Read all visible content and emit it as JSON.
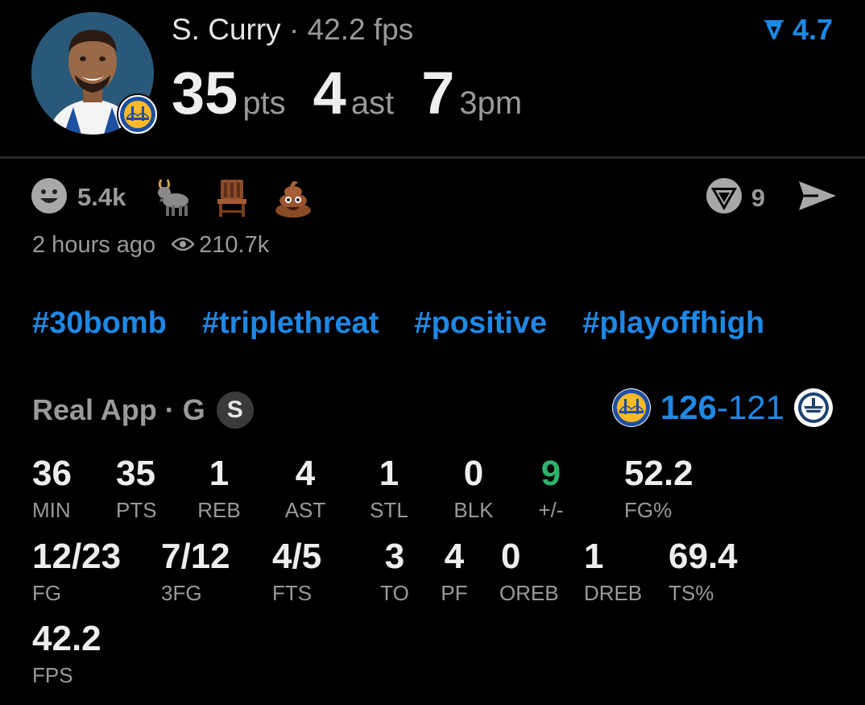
{
  "player": {
    "name": "S. Curry",
    "separator": "·",
    "fps_label": "42.2 fps"
  },
  "headline": [
    {
      "value": "35",
      "unit": "pts"
    },
    {
      "value": "4",
      "unit": "ast"
    },
    {
      "value": "7",
      "unit": "3pm"
    }
  ],
  "rating": {
    "value": "4.7",
    "icon": "rating-funnel-icon",
    "color": "#1e88e5"
  },
  "reactions": {
    "count": "5.4k",
    "emojis": [
      "goat-emoji",
      "chair-emoji",
      "poop-emoji"
    ],
    "comments": "9"
  },
  "meta": {
    "time": "2 hours ago",
    "views": "210.7k"
  },
  "hashtags": [
    "#30bomb",
    "#triplethreat",
    "#positive",
    "#playoffhigh"
  ],
  "game": {
    "source": "Real App",
    "separator": "·",
    "position": "G",
    "badge": "S",
    "home_score": "126",
    "dash": "-",
    "away_score": "121"
  },
  "stats": {
    "row1": [
      {
        "v": "36",
        "l": "MIN"
      },
      {
        "v": "35",
        "l": "PTS"
      },
      {
        "v": "1",
        "l": "REB"
      },
      {
        "v": "4",
        "l": "AST"
      },
      {
        "v": "1",
        "l": "STL"
      },
      {
        "v": "0",
        "l": "BLK"
      },
      {
        "v": "9",
        "l": "+/-"
      },
      {
        "v": "52.2",
        "l": "FG%"
      }
    ],
    "row2": [
      {
        "v": "12/23",
        "l": "FG"
      },
      {
        "v": "7/12",
        "l": "3FG"
      },
      {
        "v": "4/5",
        "l": "FTS"
      },
      {
        "v": "3",
        "l": "TO"
      },
      {
        "v": "4",
        "l": "PF"
      },
      {
        "v": "0",
        "l": "OREB"
      },
      {
        "v": "1",
        "l": "DREB"
      },
      {
        "v": "69.4",
        "l": "TS%"
      }
    ],
    "row3": [
      {
        "v": "42.2",
        "l": "FPS"
      }
    ]
  },
  "colors": {
    "accent": "#1e88e5",
    "positive": "#2fb36b",
    "muted": "#9a9a9a",
    "background": "#000000"
  }
}
